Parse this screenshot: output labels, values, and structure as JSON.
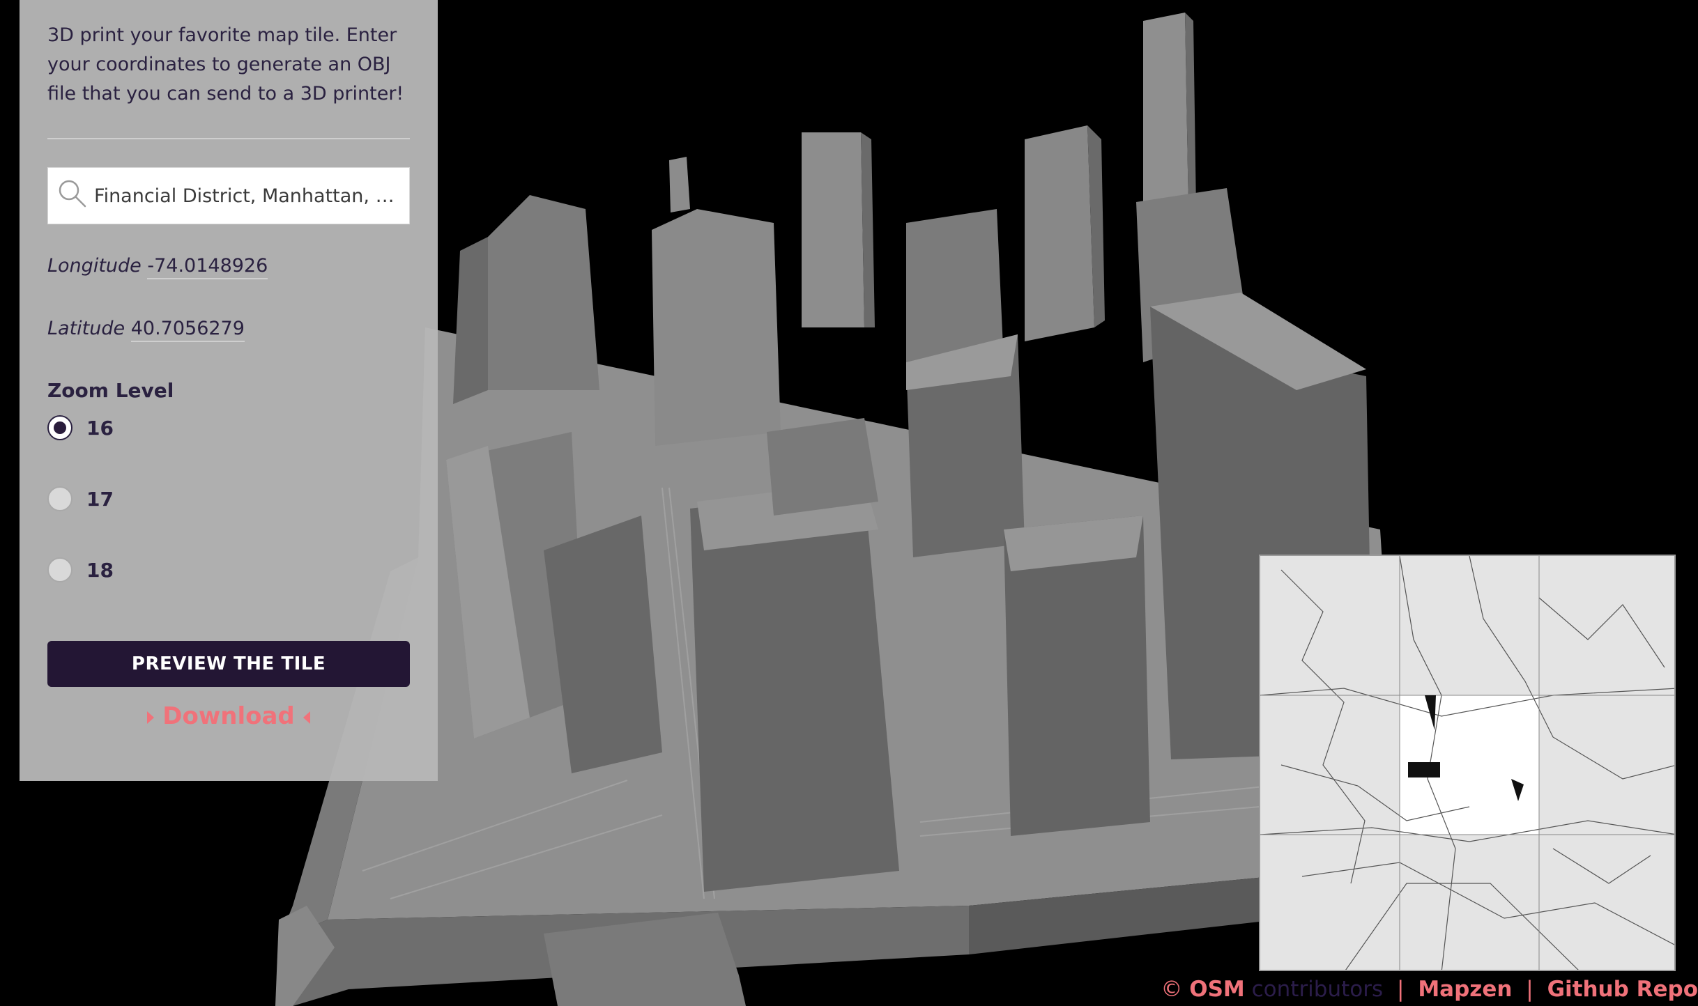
{
  "panel": {
    "intro": "3D print your favorite map tile. Enter your coordinates to generate an OBJ file that you can send to a 3D printer!",
    "search": {
      "value": "Financial District, Manhattan, Ne...",
      "icon": "search-icon"
    },
    "longitude": {
      "label": "Longitude",
      "value": "-74.0148926"
    },
    "latitude": {
      "label": "Latitude",
      "value": "40.7056279"
    },
    "zoom": {
      "title": "Zoom Level",
      "options": [
        "16",
        "17",
        "18"
      ],
      "selected": "16"
    },
    "preview_button": "PREVIEW THE TILE",
    "download_link": "Download"
  },
  "footer": {
    "copyright_symbol": "©",
    "osm": "OSM",
    "contributors": "contributors",
    "separator": "|",
    "mapzen": "Mapzen",
    "github": "Github Repo"
  },
  "colors": {
    "accent": "#f0727a",
    "button_bg": "#231634",
    "text": "#2a2140",
    "panel_bg": "#b6b6b6",
    "model_light": "#9e9e9e",
    "model_dark": "#5f5f5f"
  }
}
